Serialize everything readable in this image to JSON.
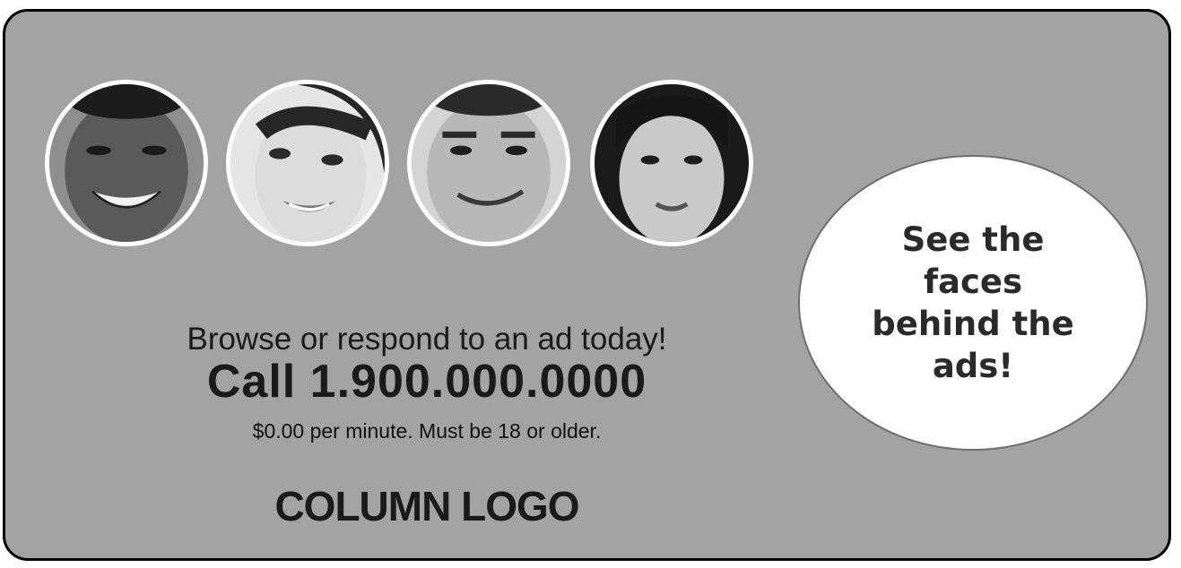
{
  "ad": {
    "tagline": "Browse or respond to an ad today!",
    "phone_line": "Call 1.900.000.0000",
    "disclaimer": "$0.00 per minute. Must be 18 or older.",
    "logo": "COLUMN LOGO",
    "promo": "See the faces behind the ads!"
  },
  "faces": [
    {
      "name": "face-photo-1",
      "skin": "#5a5a5a",
      "hair": "#1c1c1c"
    },
    {
      "name": "face-photo-2",
      "skin": "#dcdcdc",
      "hair": "#262626"
    },
    {
      "name": "face-photo-3",
      "skin": "#b8b8b8",
      "hair": "#2a2a2a"
    },
    {
      "name": "face-photo-4",
      "skin": "#c9c9c9",
      "hair": "#151515"
    }
  ],
  "colors": {
    "background": "#a3a3a3",
    "text": "#1a1a1a",
    "circle": "#ffffff"
  }
}
